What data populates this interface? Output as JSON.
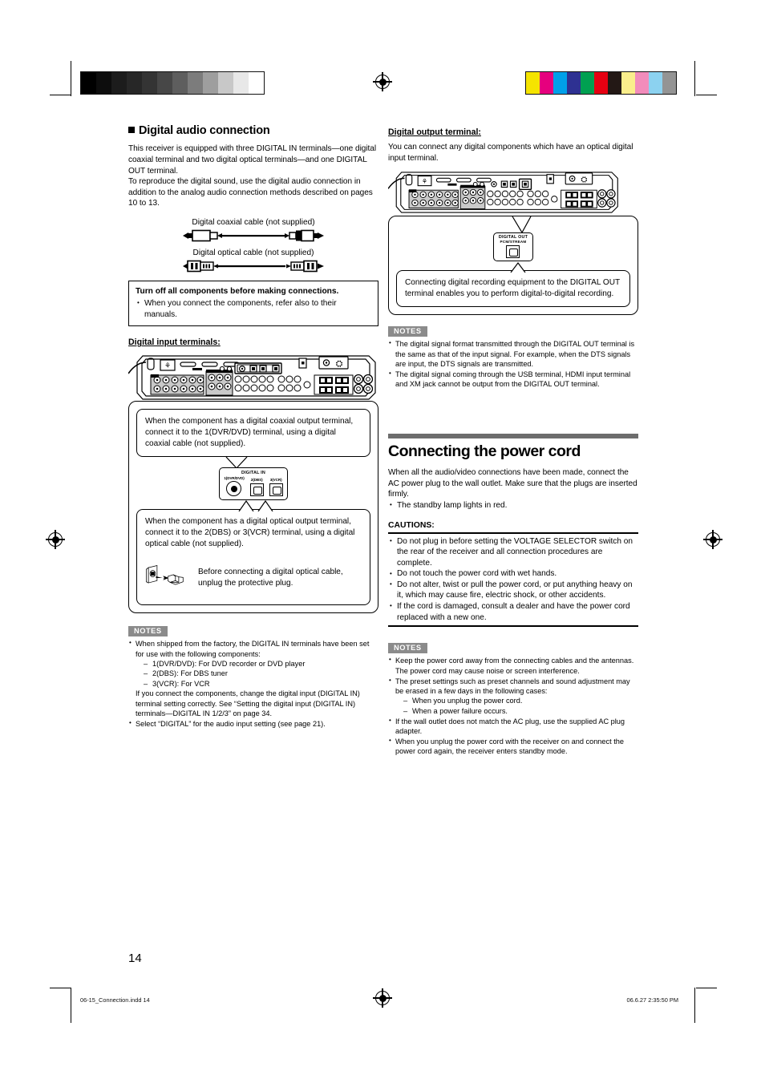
{
  "page": {
    "number": "14",
    "footer_left": "06-15_Connection.indd   14",
    "footer_right": "06.6.27   2:35:50 PM"
  },
  "print_marks": {
    "grayscale_ramp": [
      "#000000",
      "#0d0d0d",
      "#1c1c1c",
      "#272727",
      "#343434",
      "#474747",
      "#5e5e5e",
      "#7c7c7c",
      "#9e9e9e",
      "#c8c8c8",
      "#e8e8e8",
      "#ffffff"
    ],
    "cmyk_bar": [
      "#f5e400",
      "#e6007e",
      "#00a0e9",
      "#2e3192",
      "#00a051",
      "#e60012",
      "#231815",
      "#faee8c",
      "#f28cbb",
      "#8cd2f0",
      "#949494"
    ]
  },
  "left_column": {
    "heading": "Digital audio connection",
    "intro_paragraph": "This receiver is equipped with three DIGITAL IN terminals—one digital coaxial terminal and two digital optical terminals—and one DIGITAL OUT terminal.\nTo reproduce the digital sound, use the digital audio connection in addition to the analog audio connection methods described on pages 10 to 13.",
    "cables": [
      {
        "caption": "Digital coaxial cable (not supplied)",
        "icon": "coaxial-cable-icon"
      },
      {
        "caption": "Digital optical cable (not supplied)",
        "icon": "optical-cable-icon"
      }
    ],
    "warning": {
      "title": "Turn off all components before making connections.",
      "items": [
        "When you connect the components, refer also to their manuals."
      ]
    },
    "input_terminals_head": "Digital input terminals:",
    "callout_coaxial": "When the component has a digital coaxial output terminal, connect it to the 1(DVR/DVD) terminal, using a digital coaxial cable (not supplied).",
    "terminal_detail": {
      "title": "DIGITAL IN",
      "jacks": [
        {
          "label": "1(DVR/DVD)",
          "type": "coaxial"
        },
        {
          "label": "2(DBS)",
          "type": "optical"
        },
        {
          "label": "3(VCR)",
          "type": "optical"
        }
      ]
    },
    "callout_optical": "When the component has a digital optical output terminal, connect it to the 2(DBS) or 3(VCR) terminal, using a digital optical cable (not supplied).",
    "protective_plug_note": "Before connecting a digital optical cable, unplug the protective plug.",
    "notes_tag": "NOTES",
    "notes": [
      {
        "text": "When shipped from the factory, the DIGITAL IN terminals have been set for use with the following components:",
        "sub": [
          "1(DVR/DVD): For DVD recorder or DVD player",
          "2(DBS): For DBS tuner",
          "3(VCR): For VCR"
        ],
        "cont": "If you connect the components, change the digital input (DIGITAL IN) terminal setting correctly. See “Setting the digital input (DIGITAL IN) terminals—DIGITAL IN 1/2/3” on page 34."
      },
      {
        "text": "Select “DIGITAL” for the audio input setting (see page 21).",
        "sub": [],
        "cont": ""
      }
    ]
  },
  "right_column": {
    "output_head": "Digital output terminal:",
    "output_intro": "You can connect any digital components which have an optical digital input terminal.",
    "output_detail": {
      "title": "DIGITAL OUT",
      "subtitle": "PCM/STREAM"
    },
    "callout_output": "Connecting digital recording equipment to the DIGITAL OUT terminal enables you to perform digital-to-digital recording.",
    "notes_tag_1": "NOTES",
    "notes_1": [
      "The digital signal format transmitted through the DIGITAL OUT terminal is the same as that of the input signal. For example, when the DTS signals are input, the DTS signals are transmitted.",
      "The digital signal coming through the USB terminal, HDMI input terminal and XM jack cannot be output from the DIGITAL OUT terminal."
    ],
    "power_heading": "Connecting the power cord",
    "power_intro": "When all the audio/video connections have been made, connect the AC power plug to the wall outlet. Make sure that the plugs are inserted firmly.",
    "power_bullets": [
      "The standby lamp lights in red."
    ],
    "cautions_title": "CAUTIONS:",
    "cautions": [
      "Do not plug in before setting the VOLTAGE SELECTOR switch on the rear of the receiver and all connection procedures are complete.",
      "Do not touch the power cord with wet hands.",
      "Do not alter, twist or pull the power cord, or put anything heavy on it, which may cause fire, electric shock, or other accidents.",
      "If the cord is damaged, consult a dealer and have the power cord replaced with a new one."
    ],
    "notes_tag_2": "NOTES",
    "notes_2": [
      {
        "text": "Keep the power cord away from the connecting cables and the antennas. The power cord may cause noise or screen interference.",
        "sub": []
      },
      {
        "text": "The preset settings such as preset channels and sound adjustment may be erased in a few days in the following cases:",
        "sub": [
          "When you unplug the power cord.",
          "When a power failure occurs."
        ]
      },
      {
        "text": "If the wall outlet does not match the AC plug, use the supplied AC plug adapter.",
        "sub": []
      },
      {
        "text": "When you unplug the power cord with the receiver on and connect the power cord again, the receiver enters standby mode.",
        "sub": []
      }
    ]
  }
}
